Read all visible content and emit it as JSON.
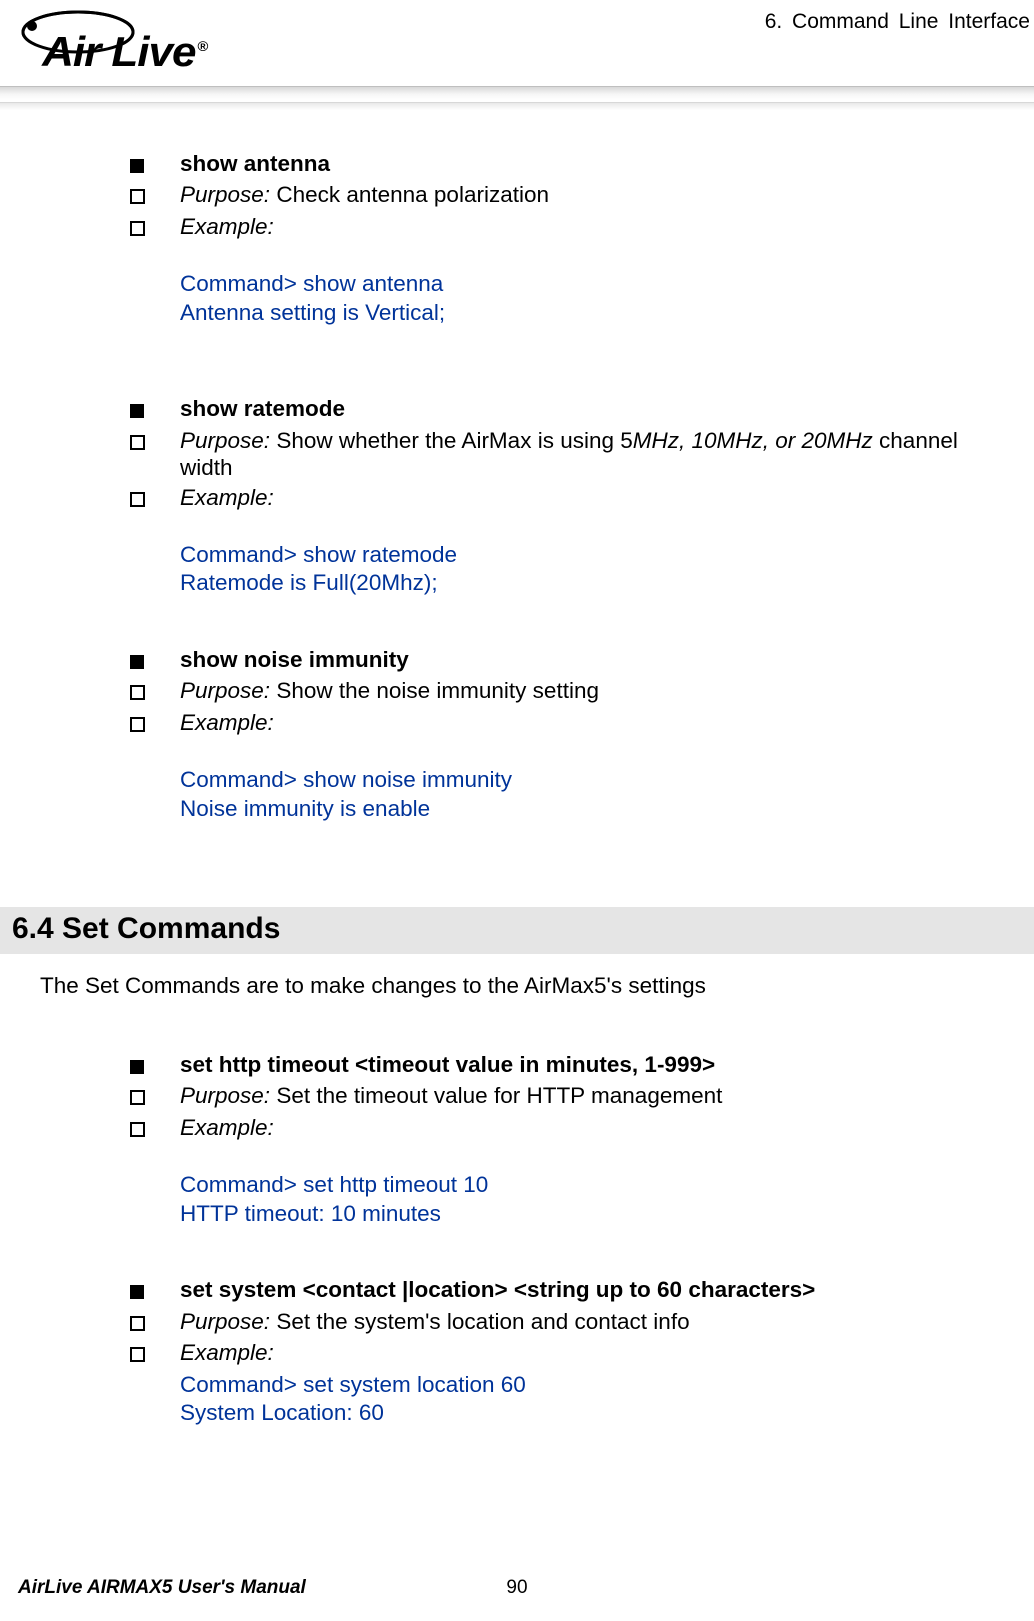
{
  "header": {
    "chapter": "6.    Command  Line  Interface",
    "logo_text": "Air Live",
    "registered": "®"
  },
  "commands": [
    {
      "title": "show antenna",
      "purpose_prefix": "Purpose:",
      "purpose": " Check antenna polarization",
      "example_label": "Example:",
      "output": [
        "Command> show antenna",
        "Antenna setting is Vertical;"
      ]
    },
    {
      "title": "show ratemode",
      "purpose_prefix": "Purpose:",
      "purpose_rich": {
        "pre": " Show whether the AirMax is using 5",
        "ital": "MHz, 10MHz, or 20MHz",
        "post": " channel width"
      },
      "example_label": "Example:",
      "output": [
        "Command> show ratemode",
        "Ratemode is Full(20Mhz);"
      ]
    },
    {
      "title": "show noise immunity",
      "purpose_prefix": "Purpose:",
      "purpose": " Show the noise immunity setting",
      "example_label": "Example:",
      "output": [
        "Command> show noise immunity",
        "Noise immunity is enable"
      ]
    }
  ],
  "section": {
    "heading": "6.4 Set  Commands",
    "intro": "The Set Commands are to make changes to the AirMax5's settings"
  },
  "set_commands": [
    {
      "title": "set http timeout <timeout value in minutes, 1-999>",
      "purpose_prefix": "Purpose:",
      "purpose": " Set the timeout value for HTTP management",
      "example_label": "Example:",
      "output_gap": true,
      "output": [
        "Command> set http timeout 10",
        "HTTP timeout: 10 minutes"
      ]
    },
    {
      "title": "set system <contact |location> <string up to 60 characters>",
      "purpose_prefix": "Purpose:",
      "purpose": " Set the system's location and contact info",
      "example_label": "Example:",
      "output_gap": false,
      "output": [
        "Command> set system location 60",
        "System Location: 60"
      ]
    }
  ],
  "footer": {
    "left": "AirLive AIRMAX5 User's Manual",
    "page": "90"
  }
}
